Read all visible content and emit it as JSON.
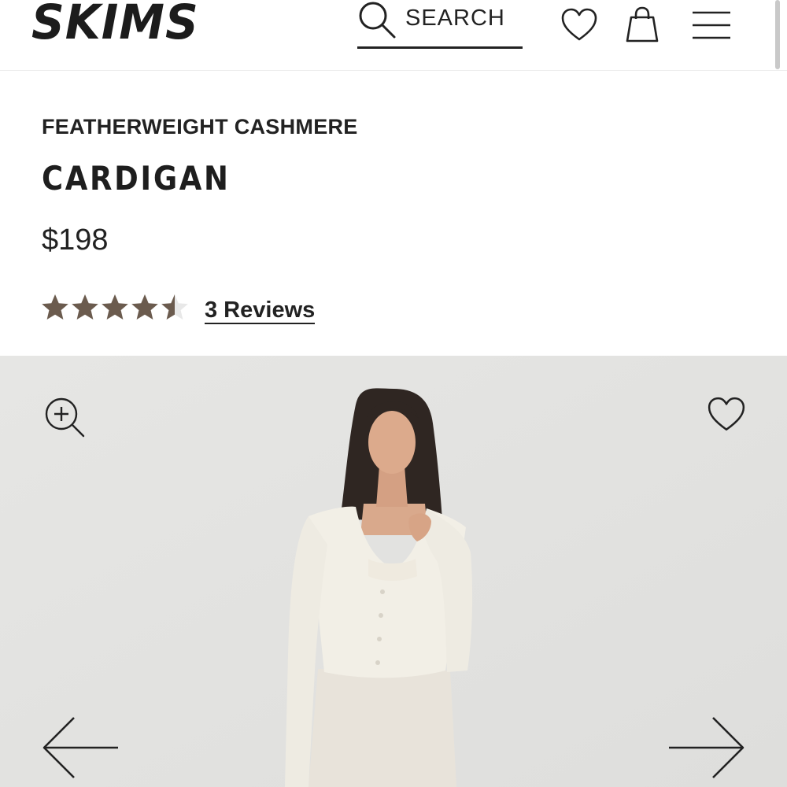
{
  "header": {
    "logo": "SKIMS",
    "search_label": "SEARCH",
    "icons": [
      "search-icon",
      "heart-icon",
      "bag-icon",
      "menu-icon"
    ]
  },
  "product": {
    "collection": "FEATHERWEIGHT CASHMERE",
    "name": "CARDIGAN",
    "price": "$198",
    "rating": 4.5,
    "rating_max": 5,
    "reviews_label": "3 Reviews"
  },
  "gallery": {
    "icons": [
      "zoom-in-icon",
      "heart-icon",
      "arrow-left-icon",
      "arrow-right-icon"
    ]
  },
  "colors": {
    "text": "#222222",
    "star_filled": "#6b5b4e",
    "star_empty": "#e8e8e8",
    "gallery_bg": "#e4e4e2"
  }
}
